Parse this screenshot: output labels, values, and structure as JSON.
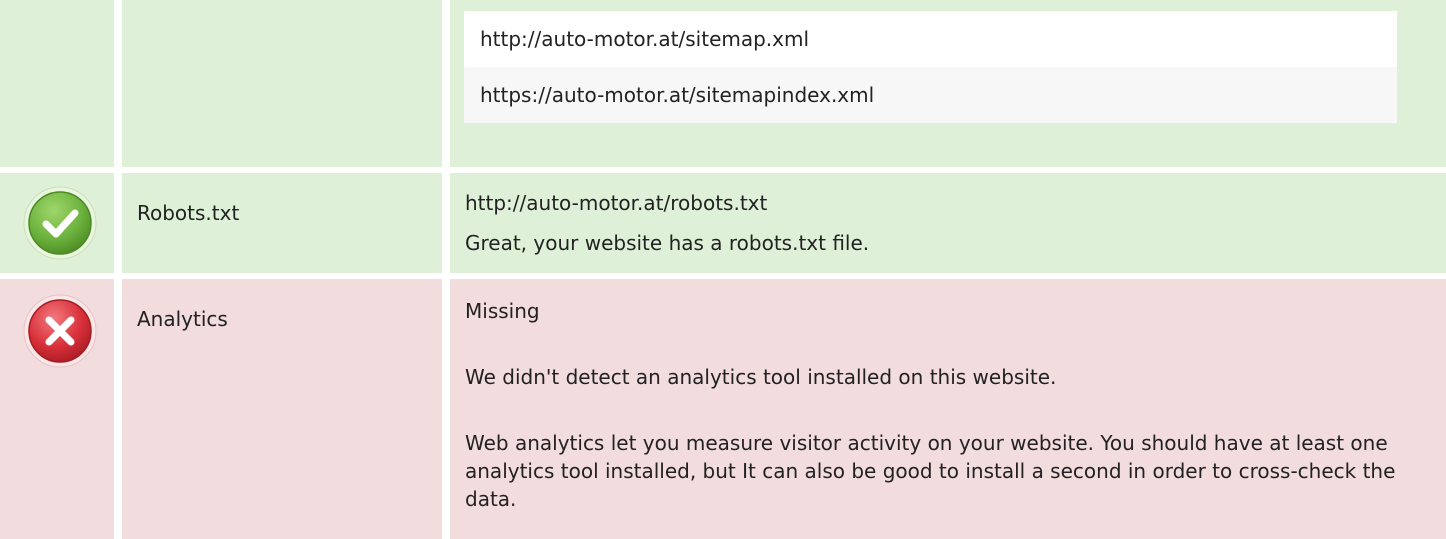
{
  "sitemap": {
    "urls": [
      "http://auto-motor.at/sitemap.xml",
      "https://auto-motor.at/sitemapindex.xml"
    ]
  },
  "robots": {
    "label": "Robots.txt",
    "value": "http://auto-motor.at/robots.txt",
    "message": "Great, your website has a robots.txt file.",
    "status_icon": "check-icon",
    "status_color": "#6db33f"
  },
  "analytics": {
    "label": "Analytics",
    "value": "Missing",
    "message": "We didn't detect an analytics tool installed on this website.",
    "description": "Web analytics let you measure visitor activity on your website. You should have at least one analytics tool installed, but It can also be good to install a second in order to cross-check the data.",
    "status_icon": "cross-icon",
    "status_color": "#d9303a"
  },
  "colors": {
    "pass_bg": "#dff0d8",
    "fail_bg": "#f2dcde"
  }
}
